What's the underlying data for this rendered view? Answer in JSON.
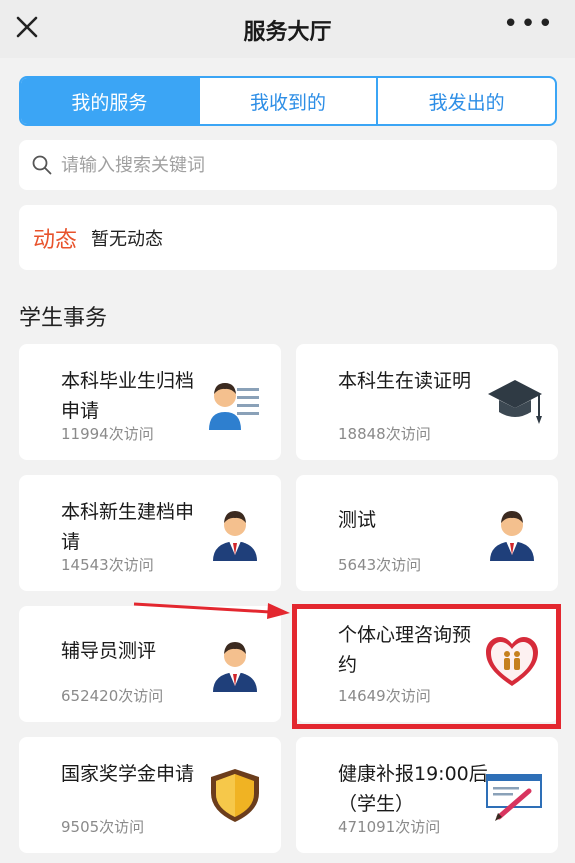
{
  "topbar": {
    "title": "服务大厅",
    "more": "•••"
  },
  "tabs": [
    {
      "label": "我的服务",
      "active": true
    },
    {
      "label": "我收到的",
      "active": false
    },
    {
      "label": "我发出的",
      "active": false
    }
  ],
  "search": {
    "placeholder": "请输入搜索关键词"
  },
  "dynamic": {
    "label": "动态",
    "text": "暂无动态"
  },
  "section": {
    "title": "学生事务"
  },
  "cards": [
    {
      "title": "本科毕业生归档申请",
      "visits": "11994次访问",
      "icon": "person-list-icon"
    },
    {
      "title": "本科生在读证明",
      "visits": "18848次访问",
      "icon": "graduation-cap-icon"
    },
    {
      "title": "本科新生建档申请",
      "visits": "14543次访问",
      "icon": "person-icon"
    },
    {
      "title": "测试",
      "visits": "5643次访问",
      "icon": "person-icon"
    },
    {
      "title": "辅导员测评",
      "visits": "652420次访问",
      "icon": "person-icon"
    },
    {
      "title": "个体心理咨询预约",
      "visits": "14649次访问",
      "icon": "heart-icon"
    },
    {
      "title": "国家奖学金申请",
      "visits": "9505次访问",
      "icon": "shield-icon"
    },
    {
      "title": "健康补报19:00后（学生）",
      "visits": "471091次访问",
      "icon": "check-pen-icon"
    }
  ],
  "colors": {
    "accent": "#3ba5f5",
    "highlight": "#e3272f",
    "dynamic_label": "#e8532c"
  }
}
